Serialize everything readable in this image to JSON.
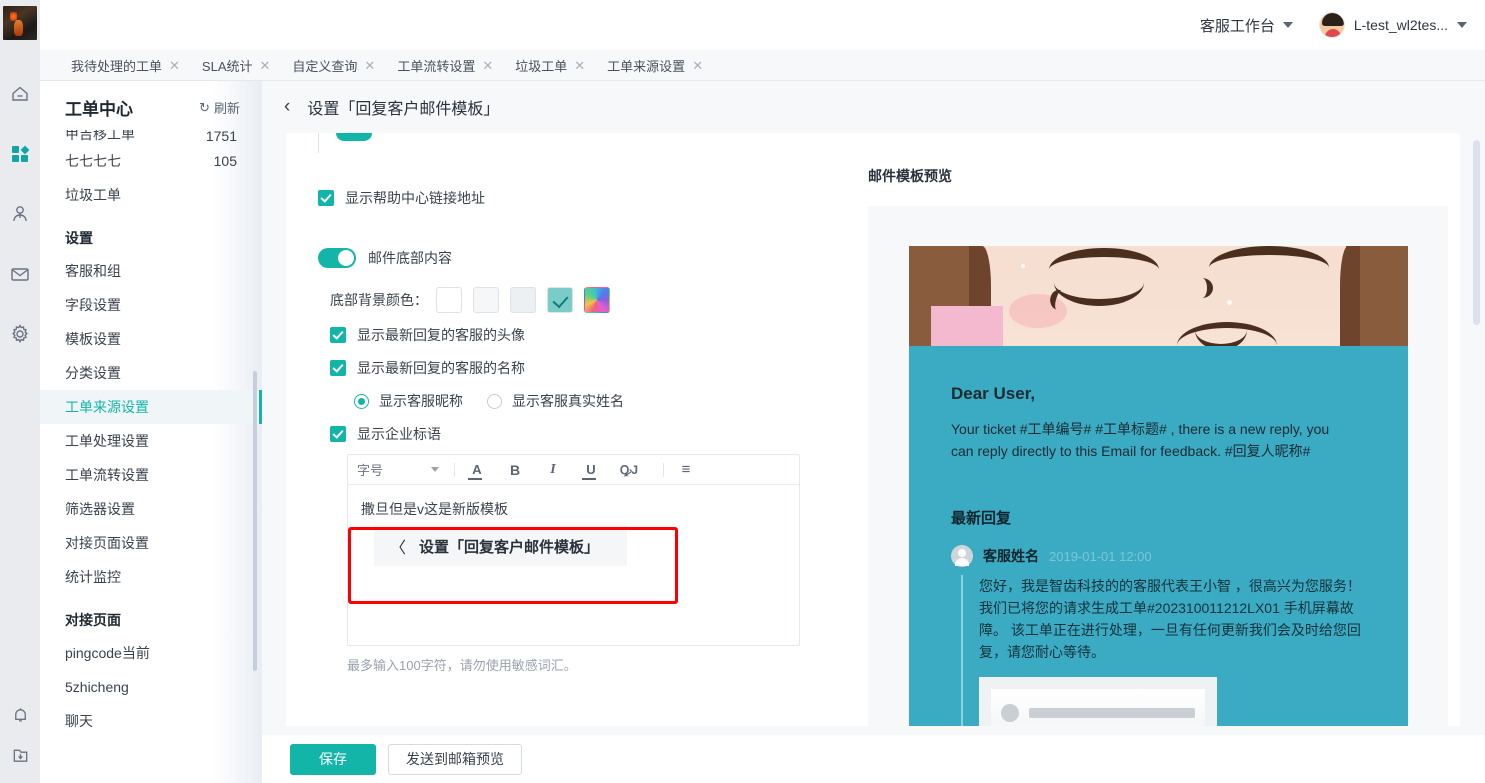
{
  "rail": {
    "logo_name": "app-logo",
    "icons": [
      {
        "name": "home-icon",
        "glyph": "⌂",
        "active": false
      },
      {
        "name": "apps-grid-icon",
        "glyph": "▣",
        "active": true
      },
      {
        "name": "customer-icon",
        "glyph": "☻",
        "active": false
      },
      {
        "name": "mail-icon",
        "glyph": "✉",
        "active": false
      },
      {
        "name": "settings-gear-icon",
        "glyph": "⚙",
        "active": false
      },
      {
        "name": "bell-icon",
        "glyph": "🔔",
        "active": false
      },
      {
        "name": "download-folder-icon",
        "glyph": "⤓",
        "active": false
      }
    ]
  },
  "header": {
    "workspace": "客服工作台",
    "user": "L-test_wl2tes..."
  },
  "tabs": [
    {
      "label": "我待处理的工单",
      "close": "✕"
    },
    {
      "label": "SLA统计",
      "close": "✕"
    },
    {
      "label": "自定义查询",
      "close": "✕"
    },
    {
      "label": "工单流转设置",
      "close": "✕"
    },
    {
      "label": "垃圾工单",
      "close": "✕"
    },
    {
      "label": "工单来源设置",
      "close": "✕"
    }
  ],
  "sidebar": {
    "title": "工单中心",
    "refresh": "刷新",
    "refresh_icon": "↻",
    "clipped_row": {
      "label": "甲吉移工单",
      "count": "1751"
    },
    "rows": [
      {
        "label": "七七七七",
        "count": "105"
      },
      {
        "label": "垃圾工单",
        "count": ""
      }
    ],
    "group_settings": "设置",
    "settings_items": [
      {
        "label": "客服和组",
        "active": false
      },
      {
        "label": "字段设置",
        "active": false
      },
      {
        "label": "模板设置",
        "active": false
      },
      {
        "label": "分类设置",
        "active": false
      },
      {
        "label": "工单来源设置",
        "active": true
      },
      {
        "label": "工单处理设置",
        "active": false
      },
      {
        "label": "工单流转设置",
        "active": false
      },
      {
        "label": "筛选器设置",
        "active": false
      },
      {
        "label": "对接页面设置",
        "active": false
      },
      {
        "label": "统计监控",
        "active": false
      }
    ],
    "group_pages": "对接页面",
    "page_items": [
      {
        "label": "pingcode当前"
      },
      {
        "label": "5zhicheng"
      },
      {
        "label": "聊天"
      }
    ]
  },
  "page": {
    "back_icon": "‹",
    "title": "设置「回复客户邮件模板」"
  },
  "form": {
    "help_center_checkbox": {
      "label": "显示帮助中心链接地址",
      "checked": true
    },
    "footer_toggle": {
      "label": "邮件底部内容",
      "on": true
    },
    "bg_color_label": "底部背景颜色：",
    "swatches": [
      {
        "name": "swatch-white",
        "color": "#ffffff",
        "selected": false
      },
      {
        "name": "swatch-light-1",
        "color": "#f5f7f9",
        "selected": false
      },
      {
        "name": "swatch-light-2",
        "color": "#edf0f3",
        "selected": false
      },
      {
        "name": "swatch-teal",
        "color": "#79ccc8",
        "selected": true
      },
      {
        "name": "swatch-custom-rainbow",
        "color": "rainbow",
        "selected": false
      }
    ],
    "show_avatar_checkbox": {
      "label": "显示最新回复的客服的头像",
      "checked": true
    },
    "show_name_checkbox": {
      "label": "显示最新回复的客服的名称",
      "checked": true
    },
    "name_radios": [
      {
        "label": "显示客服昵称",
        "selected": true
      },
      {
        "label": "显示客服真实姓名",
        "selected": false
      }
    ],
    "slogan_checkbox": {
      "label": "显示企业标语",
      "checked": true
    },
    "editor": {
      "fontsize_label": "字号",
      "tools": [
        {
          "name": "text-color-icon",
          "glyph": "A"
        },
        {
          "name": "bold-icon",
          "glyph": "B"
        },
        {
          "name": "italic-icon",
          "glyph": "I"
        },
        {
          "name": "underline-icon",
          "glyph": "U"
        },
        {
          "name": "strikethrough-icon",
          "glyph": "ꝘJ"
        },
        {
          "name": "align-icon",
          "glyph": "≡"
        }
      ],
      "content_line": "撒旦但是v这是新版模板",
      "chip_arrow": "〈",
      "chip_text": "设置「回复客户邮件模板」"
    },
    "hint": "最多输入100字符，请勿使用敏感词汇。"
  },
  "preview": {
    "title": "邮件模板预览",
    "greeting": "Dear User,",
    "intro": "Your ticket #工单编号# #工单标题# , there is a new reply, you can reply directly to this Email for feedback. #回复人昵称#",
    "latest_reply_heading": "最新回复",
    "agent_name": "客服姓名",
    "timestamp": "2019-01-01 12:00",
    "reply_body": "您好，我是智齿科技的的客服代表王小智 ，很高兴为您服务！我们已将您的请求生成工单#202310011212LX01 手机屏幕故障。 该工单正在进行处理，一旦有任何更新我们会及时给您回复，请您耐心等待。"
  },
  "footer_buttons": {
    "save": "保存",
    "send_preview": "发送到邮箱预览"
  },
  "colors": {
    "accent": "#13b5a8",
    "preview_bg": "#3aabc2",
    "highlight_box": "#ff0000"
  }
}
